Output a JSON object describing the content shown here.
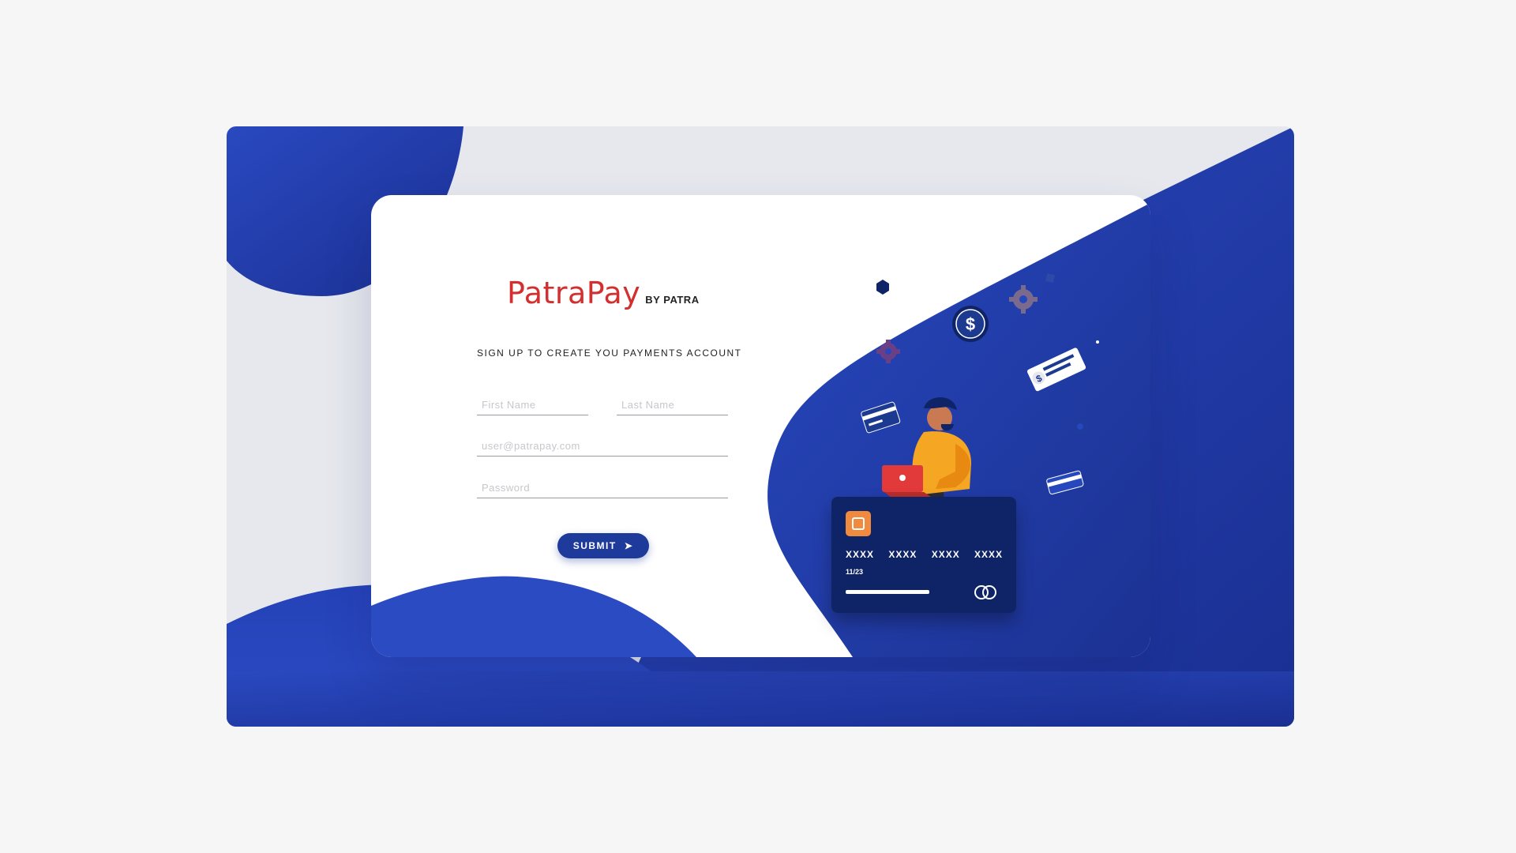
{
  "brand": {
    "name": "PatraPay",
    "by": "BY PATRA"
  },
  "form": {
    "title": "SIGN UP TO CREATE YOU PAYMENTS ACCOUNT",
    "first_name_placeholder": "First Name",
    "last_name_placeholder": "Last Name",
    "email_placeholder": "user@patrapay.com",
    "password_placeholder": "Password",
    "submit_label": "SUBMIT"
  },
  "illustration": {
    "card_number": "XXXX XXXX XXXX XXXX",
    "card_expiry": "11/23"
  },
  "colors": {
    "brand_red": "#d32f2f",
    "primary_blue": "#1e3a9a",
    "dark_navy": "#0f2466",
    "accent_orange": "#f08a3e"
  }
}
